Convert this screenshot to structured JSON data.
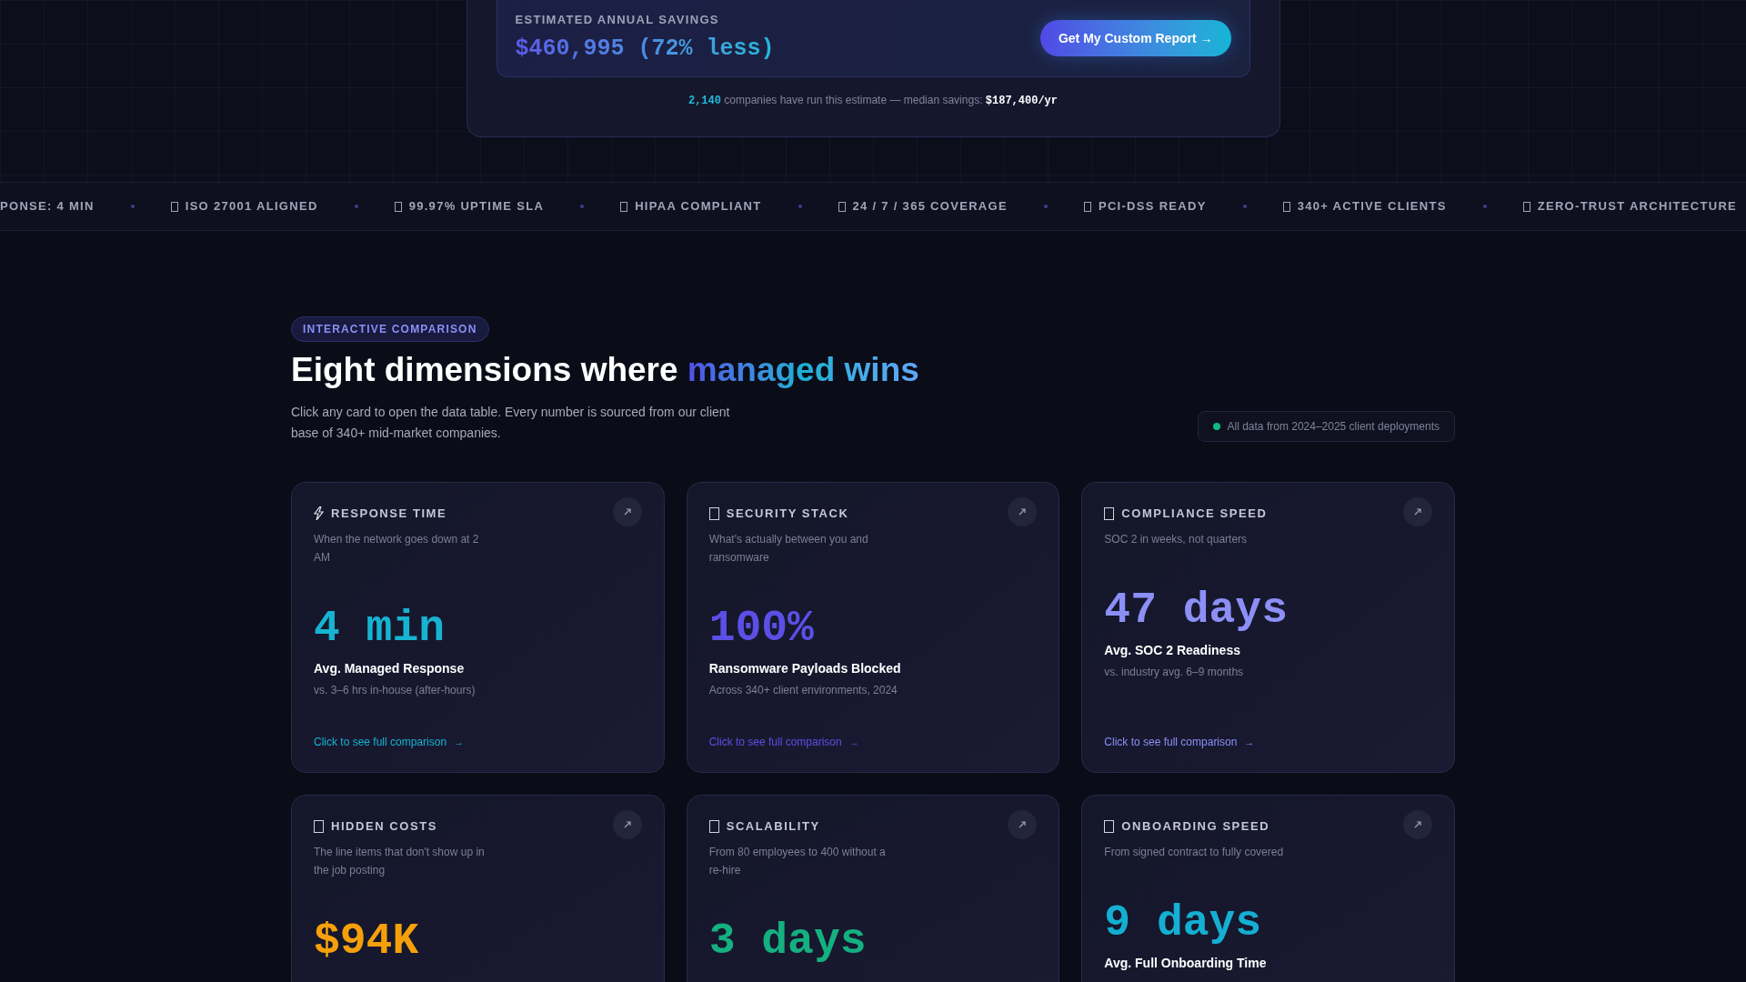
{
  "savings": {
    "label": "ESTIMATED ANNUAL SAVINGS",
    "value": "$460,995 (72% less)",
    "button": "Get My Custom Report →",
    "stats": {
      "count": "2,140",
      "text": "companies have run this estimate — median savings:",
      "amount": "$187,400/yr"
    }
  },
  "ticker": [
    {
      "text": "PONSE: 4 MIN",
      "icon": false
    },
    {
      "text": "ISO 27001 ALIGNED",
      "icon": true
    },
    {
      "text": "99.97% UPTIME SLA",
      "icon": true
    },
    {
      "text": "HIPAA COMPLIANT",
      "icon": true
    },
    {
      "text": "24 / 7 / 365 COVERAGE",
      "icon": true
    },
    {
      "text": "PCI-DSS READY",
      "icon": true
    },
    {
      "text": "340+ ACTIVE CLIENTS",
      "icon": true
    },
    {
      "text": "ZERO-TRUST ARCHITECTURE",
      "icon": true
    }
  ],
  "section": {
    "badge": "INTERACTIVE COMPARISON",
    "heading": "Eight dimensions where",
    "highlight": "managed wins",
    "description": "Click any card to open the data table. Every number is sourced from our client base of 340+ mid-market companies.",
    "note": "All data from 2024–2025 client deployments"
  },
  "cards": [
    {
      "kind": "bolt",
      "title": "RESPONSE TIME",
      "subtitle": "When the network goes down at 2 AM",
      "value": "4 min",
      "color": "#17b3d1",
      "label": "Avg. Managed Response",
      "detail": "vs. 3–6 hrs in-house (after-hours)",
      "link": "Click to see full comparison",
      "link_arrow": "→"
    },
    {
      "kind": "box",
      "title": "SECURITY STACK",
      "subtitle": "What's actually between you and ransomware",
      "value": "100%",
      "color": "#5b4fe6",
      "label": "Ransomware Payloads Blocked",
      "detail": "Across 340+ client environments, 2024",
      "link": "Click to see full comparison",
      "link_arrow": "→"
    },
    {
      "kind": "box",
      "title": "COMPLIANCE SPEED",
      "subtitle": "SOC 2 in weeks, not quarters",
      "value": "47 days",
      "color": "#8b8ff6",
      "label": "Avg. SOC 2 Readiness",
      "detail": "vs. industry avg. 6–9 months",
      "link": "Click to see full comparison",
      "link_arrow": "→"
    },
    {
      "kind": "box",
      "title": "HIDDEN COSTS",
      "subtitle": "The line items that don't show up in the job posting",
      "value": "$94K",
      "color": "#f5a00b"
    },
    {
      "kind": "box",
      "title": "SCALABILITY",
      "subtitle": "From 80 employees to 400 without a re-hire",
      "value": "3 days",
      "color": "#14b07f"
    },
    {
      "kind": "box",
      "title": "ONBOARDING SPEED",
      "subtitle": "From signed contract to fully covered",
      "value": "9 days",
      "color": "#14afd2",
      "label": "Avg. Full Onboarding Time"
    }
  ]
}
